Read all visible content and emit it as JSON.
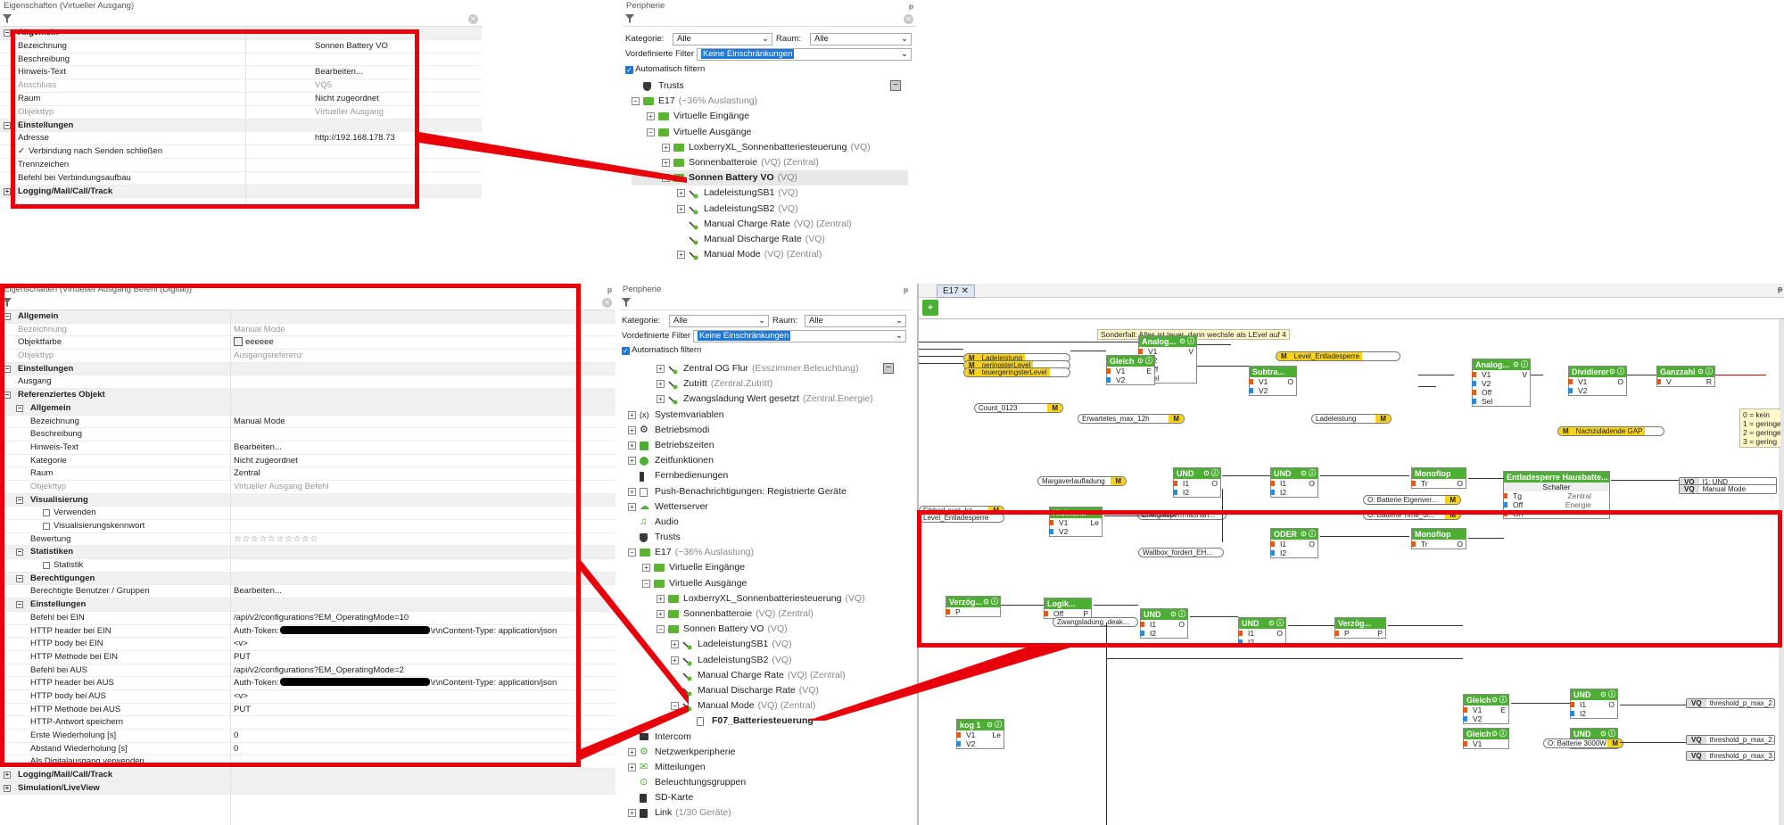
{
  "top_props": {
    "title": "Eigenschaften (Virtueller Ausgang)",
    "rows": [
      {
        "type": "sec",
        "toggle": "⊟",
        "label": "Allgemein"
      },
      {
        "label": "Bezeichnung",
        "value": "Sonnen Battery VO"
      },
      {
        "label": "Beschreibung",
        "value": ""
      },
      {
        "label": "Hinweis-Text",
        "value": "Bearbeiten..."
      },
      {
        "label": "Anschluss",
        "value": "VQ5",
        "grey": true
      },
      {
        "label": "Raum",
        "value": "Nicht zugeordnet"
      },
      {
        "label": "Objekttyp",
        "value": "Virtueller Ausgang",
        "grey": true
      },
      {
        "type": "sec",
        "toggle": "⊟",
        "label": "Einstellungen"
      },
      {
        "label": "Adresse",
        "value": "http://192.168.178.73"
      },
      {
        "label": "Verbindung nach Senden schließen",
        "value": "",
        "check": true
      },
      {
        "label": "Trennzeichen",
        "value": ""
      },
      {
        "label": "Befehl bei Verbindungsaufbau",
        "value": ""
      },
      {
        "type": "sec",
        "toggle": "⊞",
        "label": "Logging/Mail/Call/Track"
      }
    ]
  },
  "top_periph": {
    "title": "Peripherie",
    "kategorie_label": "Kategorie:",
    "kategorie_value": "Alle",
    "raum_label": "Raum:",
    "raum_value": "Alle",
    "filter_label": "Vordefinierte Filter",
    "filter_value": "Keine Einschränkungen",
    "auto_label": "Automatisch filtern",
    "tree": [
      {
        "lvl": 0,
        "exp": "",
        "icon": "trust",
        "text": "Trusts",
        "sub": ""
      },
      {
        "lvl": 0,
        "exp": "⊟",
        "icon": "green",
        "text": "E17",
        "sub": "(~36% Auslastung)"
      },
      {
        "lvl": 1,
        "exp": "⊞",
        "icon": "green",
        "text": "Virtuelle Eingänge",
        "sub": ""
      },
      {
        "lvl": 1,
        "exp": "⊟",
        "icon": "green",
        "text": "Virtuelle Ausgänge",
        "sub": ""
      },
      {
        "lvl": 2,
        "exp": "⊞",
        "icon": "green",
        "text": "LoxberryXL_Sonnenbatteriesteuerung",
        "sub": "(VQ)"
      },
      {
        "lvl": 2,
        "exp": "⊞",
        "icon": "green",
        "text": "Sonnenbatteroie",
        "sub": "(VQ) (Zentral)"
      },
      {
        "lvl": 2,
        "exp": "⊟",
        "icon": "green",
        "text": "Sonnen Battery VO",
        "sub": "(VQ)",
        "sel": true
      },
      {
        "lvl": 3,
        "exp": "⊞",
        "icon": "out",
        "text": "LadeleistungSB1",
        "sub": "(VQ)"
      },
      {
        "lvl": 3,
        "exp": "⊞",
        "icon": "out",
        "text": "LadeleistungSB2",
        "sub": "(VQ)"
      },
      {
        "lvl": 3,
        "exp": "",
        "icon": "out",
        "text": "Manual Charge Rate",
        "sub": "(VQ) (Zentral)"
      },
      {
        "lvl": 3,
        "exp": "",
        "icon": "out",
        "text": "Manual Discharge Rate",
        "sub": "(VQ)"
      },
      {
        "lvl": 3,
        "exp": "⊞",
        "icon": "out",
        "text": "Manual Mode",
        "sub": "(VQ) (Zentral)"
      }
    ]
  },
  "bot_props": {
    "title": "Eigenschaften (Virtueller Ausgang Befehl (Digital))",
    "rows": [
      {
        "type": "sec",
        "lvl": 0,
        "toggle": "⊟",
        "label": "Allgemein"
      },
      {
        "lvl": 0,
        "label": "Bezeichnung",
        "value": "Manual Mode",
        "grey": true
      },
      {
        "lvl": 0,
        "label": "Objektfarbe",
        "value": "eeeeee",
        "swatch": true
      },
      {
        "lvl": 0,
        "label": "Objekttyp",
        "value": "Ausgangsreferenz",
        "grey": true
      },
      {
        "type": "sec",
        "lvl": 0,
        "toggle": "⊟",
        "label": "Einstellungen"
      },
      {
        "lvl": 0,
        "label": "Ausgang",
        "value": ""
      },
      {
        "type": "sec",
        "lvl": 0,
        "toggle": "⊟",
        "label": "Referenziertes Objekt"
      },
      {
        "type": "sec",
        "lvl": 1,
        "toggle": "⊟",
        "label": "Allgemein"
      },
      {
        "lvl": 1,
        "label": "Bezeichnung",
        "value": "Manual Mode"
      },
      {
        "lvl": 1,
        "label": "Beschreibung",
        "value": ""
      },
      {
        "lvl": 1,
        "label": "Hinweis-Text",
        "value": "Bearbeiten..."
      },
      {
        "lvl": 1,
        "label": "Kategorie",
        "value": "Nicht zugeordnet"
      },
      {
        "lvl": 1,
        "label": "Raum",
        "value": "Zentral"
      },
      {
        "lvl": 1,
        "label": "Objekttyp",
        "value": "Virtueller Ausgang Befehl",
        "grey": true
      },
      {
        "type": "sec",
        "lvl": 1,
        "toggle": "⊟",
        "label": "Visualisierung"
      },
      {
        "lvl": 2,
        "label": "Verwenden",
        "value": "",
        "box": true
      },
      {
        "lvl": 2,
        "label": "Visualisierungskennwort",
        "value": "",
        "box": true
      },
      {
        "lvl": 1,
        "label": "Bewertung",
        "value": "☆☆☆☆☆☆☆☆☆☆"
      },
      {
        "type": "sec",
        "lvl": 1,
        "toggle": "⊟",
        "label": "Statistiken"
      },
      {
        "lvl": 2,
        "label": "Statistik",
        "value": "",
        "box": true
      },
      {
        "type": "sec",
        "lvl": 1,
        "toggle": "⊟",
        "label": "Berechtigungen"
      },
      {
        "lvl": 1,
        "label": "Berechtigte Benutzer / Gruppen",
        "value": "Bearbeiten..."
      },
      {
        "type": "sec",
        "lvl": 1,
        "toggle": "⊟",
        "label": "Einstellungen"
      },
      {
        "lvl": 1,
        "label": "Befehl bei EIN",
        "value": "/api/v2/configurations?EM_OperatingMode=10"
      },
      {
        "lvl": 1,
        "label": "HTTP header bei EIN",
        "value": "Auth-Token:",
        "redact": true,
        "value2": "\\r\\nContent-Type: application/json"
      },
      {
        "lvl": 1,
        "label": "HTTP body bei EIN",
        "value": "<v>"
      },
      {
        "lvl": 1,
        "label": "HTTP Methode bei EIN",
        "value": "PUT"
      },
      {
        "lvl": 1,
        "label": "Befehl bei AUS",
        "value": "/api/v2/configurations?EM_OperatingMode=2"
      },
      {
        "lvl": 1,
        "label": "HTTP header bei AUS",
        "value": "Auth-Token:",
        "redact": true,
        "value2": "\\r\\nContent-Type: application/json"
      },
      {
        "lvl": 1,
        "label": "HTTP body bei AUS",
        "value": "<v>"
      },
      {
        "lvl": 1,
        "label": "HTTP Methode bei AUS",
        "value": "PUT"
      },
      {
        "lvl": 1,
        "label": "HTTP-Antwort speichern",
        "value": ""
      },
      {
        "lvl": 1,
        "label": "Erste Wiederholung [s]",
        "value": "0"
      },
      {
        "lvl": 1,
        "label": "Abstand Wiederholung [s]",
        "value": "0"
      },
      {
        "lvl": 1,
        "label": "Als Digitalausgang verwenden",
        "value": ""
      },
      {
        "type": "sec",
        "lvl": 0,
        "toggle": "⊞",
        "label": "Logging/Mail/Call/Track"
      },
      {
        "type": "sec",
        "lvl": 0,
        "toggle": "⊞",
        "label": "Simulation/LiveView"
      }
    ]
  },
  "bot_periph": {
    "title": "Peripherie",
    "kategorie_label": "Kategorie:",
    "kategorie_value": "Alle",
    "raum_label": "Raum:",
    "raum_value": "Alle",
    "filter_label": "Vordefinierte Filter",
    "filter_value": "Keine Einschränkungen",
    "auto_label": "Automatisch filtern",
    "tree": [
      {
        "lvl": 2,
        "exp": "⊞",
        "icon": "out",
        "text": "Zentral OG Flur",
        "sub": "(Esszimmer.Beleuchtung)"
      },
      {
        "lvl": 2,
        "exp": "⊞",
        "icon": "out",
        "text": "Zutritt",
        "sub": "(Zentral.Zutritt)"
      },
      {
        "lvl": 2,
        "exp": "⊞",
        "icon": "out",
        "text": "Zwangsladung Wert gesetzt",
        "sub": "(Zentral.Energie)"
      },
      {
        "lvl": 0,
        "exp": "⊞",
        "icon": "x",
        "text": "Systemvariablen",
        "sub": ""
      },
      {
        "lvl": 0,
        "exp": "⊞",
        "icon": "gear",
        "text": "Betriebsmodi",
        "sub": ""
      },
      {
        "lvl": 0,
        "exp": "⊞",
        "icon": "cal",
        "text": "Betriebszeiten",
        "sub": ""
      },
      {
        "lvl": 0,
        "exp": "⊞",
        "icon": "clock",
        "text": "Zeitfunktionen",
        "sub": ""
      },
      {
        "lvl": 0,
        "exp": "",
        "icon": "remote",
        "text": "Fernbedienungen",
        "sub": ""
      },
      {
        "lvl": 0,
        "exp": "⊞",
        "icon": "push",
        "text": "Push-Benachrichtigungen: Registrierte Geräte",
        "sub": ""
      },
      {
        "lvl": 0,
        "exp": "⊞",
        "icon": "weather",
        "text": "Wetterserver",
        "sub": ""
      },
      {
        "lvl": 0,
        "exp": "",
        "icon": "audio",
        "text": "Audio",
        "sub": ""
      },
      {
        "lvl": 0,
        "exp": "",
        "icon": "trust",
        "text": "Trusts",
        "sub": ""
      },
      {
        "lvl": 0,
        "exp": "⊟",
        "icon": "green",
        "text": "E17",
        "sub": "(~36% Auslastung)"
      },
      {
        "lvl": 1,
        "exp": "⊞",
        "icon": "green",
        "text": "Virtuelle Eingänge",
        "sub": ""
      },
      {
        "lvl": 1,
        "exp": "⊟",
        "icon": "green",
        "text": "Virtuelle Ausgänge",
        "sub": ""
      },
      {
        "lvl": 2,
        "exp": "⊞",
        "icon": "green",
        "text": "LoxberryXL_Sonnenbatteriesteuerung",
        "sub": "(VQ)"
      },
      {
        "lvl": 2,
        "exp": "⊞",
        "icon": "green",
        "text": "Sonnenbatteroie",
        "sub": "(VQ) (Zentral)"
      },
      {
        "lvl": 2,
        "exp": "⊟",
        "icon": "green",
        "text": "Sonnen Battery VO",
        "sub": "(VQ)"
      },
      {
        "lvl": 3,
        "exp": "⊞",
        "icon": "out",
        "text": "LadeleistungSB1",
        "sub": "(VQ)"
      },
      {
        "lvl": 3,
        "exp": "⊞",
        "icon": "out",
        "text": "LadeleistungSB2",
        "sub": "(VQ)"
      },
      {
        "lvl": 3,
        "exp": "",
        "icon": "out",
        "text": "Manual Charge Rate",
        "sub": "(VQ) (Zentral)"
      },
      {
        "lvl": 3,
        "exp": "",
        "icon": "out",
        "text": "Manual Discharge Rate",
        "sub": "(VQ)"
      },
      {
        "lvl": 3,
        "exp": "⊟",
        "icon": "out",
        "text": "Manual Mode",
        "sub": "(VQ) (Zentral)"
      },
      {
        "lvl": 4,
        "exp": "",
        "icon": "page",
        "text": "F07_Batteriesteuerung",
        "sub": "",
        "bold": true
      },
      {
        "lvl": 0,
        "exp": "",
        "icon": "intercom",
        "text": "Intercom",
        "sub": ""
      },
      {
        "lvl": 0,
        "exp": "⊞",
        "icon": "net",
        "text": "Netzwerkperipherie",
        "sub": ""
      },
      {
        "lvl": 0,
        "exp": "⊞",
        "icon": "msg",
        "text": "Mitteilungen",
        "sub": ""
      },
      {
        "lvl": 0,
        "exp": "",
        "icon": "light",
        "text": "Beleuchtungsgruppen",
        "sub": ""
      },
      {
        "lvl": 0,
        "exp": "",
        "icon": "sd",
        "text": "SD-Karte",
        "sub": ""
      },
      {
        "lvl": 0,
        "exp": "⊞",
        "icon": "link",
        "text": "Link",
        "sub": "(1/30 Geräte)"
      }
    ]
  },
  "diagram": {
    "tab": "E17",
    "note": "Sonderfall: Alles ist teuer, dann wechsle als LEvel auf 4",
    "legend": [
      "0 = kein",
      "1 = geringe",
      "2 = geringe",
      "3 = gering"
    ],
    "blocks": {
      "analog1": {
        "title": "Analog...",
        "in": [
          "V1",
          "V2",
          "Off",
          "Sel"
        ],
        "out": "V"
      },
      "gleich1": {
        "title": "Gleich",
        "in": [
          "V1",
          "V2"
        ],
        "out": "E"
      },
      "subtra": {
        "title": "Subtra...",
        "in": [
          "V1",
          "V2"
        ],
        "out": "O"
      },
      "analog2": {
        "title": "Analog...",
        "in": [
          "V1",
          "V2",
          "Off",
          "Sel"
        ],
        "out": "V"
      },
      "dividierer": {
        "title": "Dividierer",
        "in": [
          "V1",
          "V2"
        ],
        "out": "O"
      },
      "ganzzahl": {
        "title": "Ganzzahl",
        "in": [
          "V"
        ],
        "out": "R"
      },
      "und1": {
        "title": "UND",
        "in": [
          "I1",
          "I2"
        ],
        "out": "O"
      },
      "und2": {
        "title": "UND",
        "in": [
          "I1",
          "I2"
        ],
        "out": "O"
      },
      "monoflop1": {
        "title": "Monoflop",
        "in": [
          "Tr"
        ],
        "out": "O"
      },
      "kleiner": {
        "title": "Kleiner...",
        "in": [
          "V1",
          "V2"
        ],
        "out": "Le"
      },
      "oder": {
        "title": "ODER",
        "in": [
          "I1",
          "I2"
        ],
        "out": "O"
      },
      "monoflop2": {
        "title": "Monoflop",
        "in": [
          "Tr"
        ],
        "out": "O"
      },
      "entlade": {
        "title": "Entladesperre Hausbatte...",
        "sub": "Schalter",
        "rows": [
          "Tg",
          "Off",
          "On"
        ],
        "right": [
          "Zentral",
          "Energie"
        ]
      },
      "verz1": {
        "title": "Verzög...",
        "in": [
          "P"
        ],
        "out": ""
      },
      "lo": {
        "title": "Logik...",
        "in": [
          "Off"
        ],
        "out": "P"
      },
      "und3": {
        "title": "UND",
        "in": [
          "I1",
          "I2"
        ],
        "out": "O"
      },
      "und4": {
        "title": "UND",
        "in": [
          "I1",
          "I2"
        ],
        "out": "O"
      },
      "verz2": {
        "title": "Verzög...",
        "in": [
          "P"
        ],
        "out": "P"
      },
      "gleich2": {
        "title": "Gleich",
        "in": [
          "V1",
          "V2"
        ],
        "out": "E"
      },
      "und5": {
        "title": "UND",
        "in": [
          "I1",
          "I2"
        ],
        "out": "O"
      },
      "kog": {
        "title": "kog 1",
        "in": [
          "V1",
          "V2"
        ],
        "out": "Le"
      },
      "gleich3": {
        "title": "Gleich",
        "in": [
          "V1"
        ],
        "out": ""
      },
      "und6": {
        "title": "UND",
        "in": [
          "I1"
        ],
        "out": ""
      }
    },
    "memories": {
      "ladeleistung": "Ladeleistung",
      "geringster": "geringsterLevel",
      "teuergering": "teuergeringsterLevel",
      "count": "Count_0123",
      "entladesperre": "Level_Entladesperre",
      "erwartetes": "Erwartetes_max_12h",
      "ladeleistung2": "Ladeleistung",
      "nachzuladende": "Nachzuladende GAP",
      "margaven": "Margaverlaufladung",
      "energiesperre": "Energiesperrmaßnah...",
      "batt1": "O: Batterie Eigenver...",
      "batt2": "O: Batterie Time_of...",
      "wallbox": "Wallbox_fordert_EH...",
      "fibber": "FibberLevel_Ist",
      "levelent": "Level_Entladesperre",
      "zwang": "Zwangsladung_deak...",
      "batt3000": "O: Batterie 3000W",
      "vq1": "I1: UND",
      "vq2": "Manual Mode",
      "thr1": "threshold_p_max_2...",
      "thr2": "threshold_p_max_2...",
      "thr3": "threshold_p_max_3..."
    },
    "prefix_m": "M",
    "prefix_vq": "VQ",
    "prefix_vi": "VI"
  }
}
